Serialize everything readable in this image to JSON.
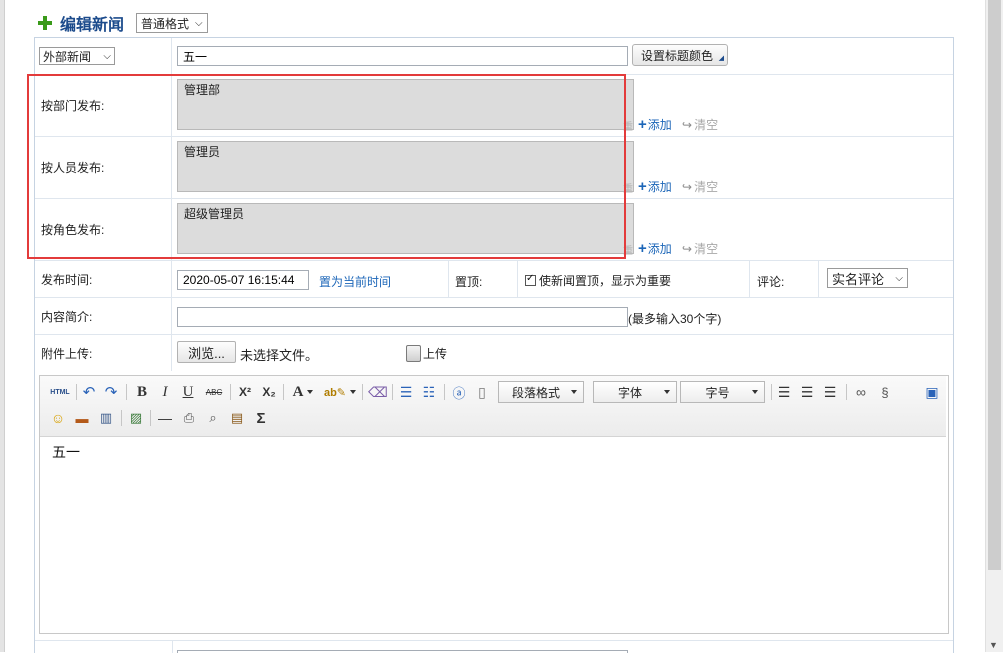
{
  "header": {
    "title": "编辑新闻",
    "format_select": "普通格式"
  },
  "form": {
    "category_select": "外部新闻",
    "title_value": "五一",
    "title_color_button": "设置标题颜色",
    "publish_targets": [
      {
        "label": "按部门发布:",
        "value": "管理部",
        "add": "添加",
        "clear": "清空"
      },
      {
        "label": "按人员发布:",
        "value": "管理员",
        "add": "添加",
        "clear": "清空"
      },
      {
        "label": "按角色发布:",
        "value": "超级管理员",
        "add": "添加",
        "clear": "清空"
      }
    ],
    "publish_time": {
      "label": "发布时间:",
      "value": "2020-05-07 16:15:44",
      "set_now": "置为当前时间"
    },
    "pin": {
      "label": "置顶:",
      "checkbox_text": "使新闻置顶，显示为重要",
      "checked": true
    },
    "comment": {
      "label": "评论:",
      "select": "实名评论"
    },
    "summary": {
      "label": "内容简介:",
      "value": "",
      "hint": "(最多输入30个字)"
    },
    "attachment": {
      "label": "附件上传:",
      "browse_button": "浏览...",
      "no_file_text": "未选择文件。",
      "upload_text": "上传"
    }
  },
  "editor": {
    "toolbar": {
      "html_btn": "HTML",
      "bold": "B",
      "italic": "I",
      "underline": "U",
      "strike": "ABC",
      "sup": "X²",
      "sub": "X₂",
      "font_color": "A",
      "sigma": "Σ",
      "paragraph_select": "段落格式",
      "font_select": "字体",
      "size_select": "字号"
    },
    "content": "五一"
  }
}
